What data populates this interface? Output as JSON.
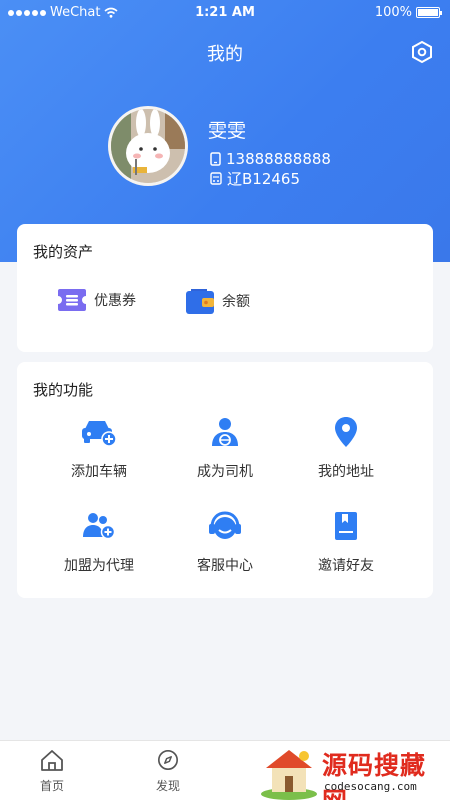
{
  "status_bar": {
    "carrier": "WeChat",
    "time": "1:21 AM",
    "battery": "100%"
  },
  "header": {
    "title": "我的"
  },
  "profile": {
    "name": "雯雯",
    "phone": "13888888888",
    "plate": "辽B12465"
  },
  "assets": {
    "title": "我的资产",
    "items": [
      {
        "label": "优惠券",
        "icon": "coupon-icon"
      },
      {
        "label": "余额",
        "icon": "wallet-icon"
      }
    ]
  },
  "functions": {
    "title": "我的功能",
    "items": [
      {
        "label": "添加车辆",
        "icon": "add-car-icon"
      },
      {
        "label": "成为司机",
        "icon": "driver-icon"
      },
      {
        "label": "我的地址",
        "icon": "location-pin-icon"
      },
      {
        "label": "加盟为代理",
        "icon": "join-agent-icon"
      },
      {
        "label": "客服中心",
        "icon": "headset-icon"
      },
      {
        "label": "邀请好友",
        "icon": "invite-book-icon"
      }
    ]
  },
  "tabbar": {
    "items": [
      {
        "label": "首页",
        "icon": "home-icon"
      },
      {
        "label": "发现",
        "icon": "compass-icon"
      }
    ]
  },
  "watermark": {
    "title": "源码搜藏网",
    "subtitle": "codesocang.com"
  },
  "colors": {
    "header_blue": "#3c7ef0",
    "icon_blue": "#2f7ef3",
    "coupon_purple": "#7a6cf0",
    "watermark_red": "#e02b1e"
  }
}
